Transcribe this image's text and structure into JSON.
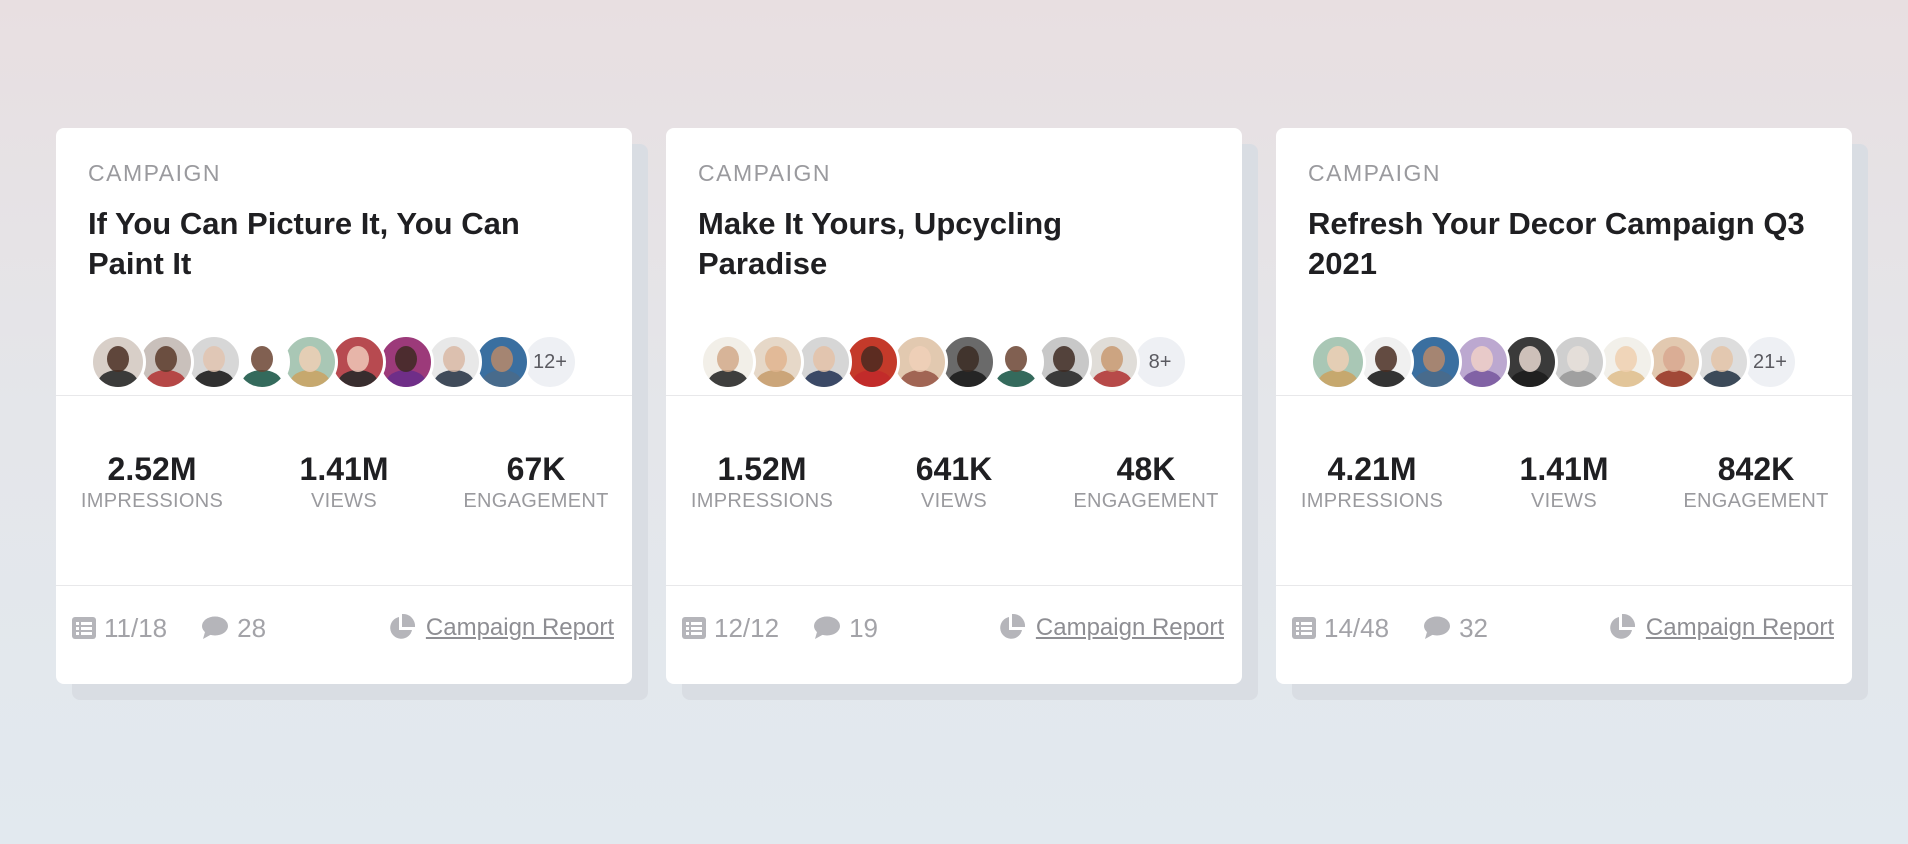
{
  "cards": [
    {
      "kicker": "CAMPAIGN",
      "title": "If You Can Picture It, You Can Paint It",
      "more_count": "12+",
      "avatars": [
        {
          "face": "#4a2e22",
          "body": "#2a2a2a",
          "bg": "#d8cfc8"
        },
        {
          "face": "#5a3a2a",
          "body": "#b23a3a",
          "bg": "#c9c0bb"
        },
        {
          "face": "#e2c4b0",
          "body": "#1e1e1e",
          "bg": "#d7d7d7"
        },
        {
          "face": "#6b4433",
          "body": "#1e5a4a",
          "bg": "#ffffff"
        },
        {
          "face": "#efcfb5",
          "body": "#c9a466",
          "bg": "#a9c7b5"
        },
        {
          "face": "#f0c8b8",
          "body": "#2a2a2a",
          "bg": "#b74a50"
        },
        {
          "face": "#3e2a22",
          "body": "#6a2e8a",
          "bg": "#9c3a7a"
        },
        {
          "face": "#d9b9a4",
          "body": "#2e3a4a",
          "bg": "#e8e8e8"
        },
        {
          "face": "#b88a6a",
          "body": "#4a6a8a",
          "bg": "#3a6fa0"
        }
      ],
      "stats": [
        {
          "value": "2.52M",
          "label": "IMPRESSIONS"
        },
        {
          "value": "1.41M",
          "label": "VIEWS"
        },
        {
          "value": "67K",
          "label": "ENGAGEMENT"
        }
      ],
      "tasks": "11/18",
      "comments": "28",
      "report_label": "Campaign Report"
    },
    {
      "kicker": "CAMPAIGN",
      "title": "Make It Yours, Upcycling Paradise",
      "more_count": "8+",
      "avatars": [
        {
          "face": "#d2a98a",
          "body": "#2a2a2a",
          "bg": "#f2efe8"
        },
        {
          "face": "#e0b58f",
          "body": "#c8a070",
          "bg": "#e6d8c8"
        },
        {
          "face": "#e4c2a8",
          "body": "#2a3a5a",
          "bg": "#d6d6d6"
        },
        {
          "face": "#4a2a20",
          "body": "#c22a2a",
          "bg": "#c43a2a"
        },
        {
          "face": "#f0d0b8",
          "body": "#9a5a4a",
          "bg": "#e2c9b0"
        },
        {
          "face": "#3a2a22",
          "body": "#1e1e1e",
          "bg": "#6a6a6a"
        },
        {
          "face": "#6b4433",
          "body": "#1e5a4a",
          "bg": "#ffffff"
        },
        {
          "face": "#3e2a22",
          "body": "#2a2a2a",
          "bg": "#c8c8c8"
        },
        {
          "face": "#c89a72",
          "body": "#b23a3a",
          "bg": "#e0ddd8"
        }
      ],
      "stats": [
        {
          "value": "1.52M",
          "label": "IMPRESSIONS"
        },
        {
          "value": "641K",
          "label": "VIEWS"
        },
        {
          "value": "48K",
          "label": "ENGAGEMENT"
        }
      ],
      "tasks": "12/12",
      "comments": "19",
      "report_label": "Campaign Report"
    },
    {
      "kicker": "CAMPAIGN",
      "title": "Refresh Your Decor Campaign Q3 2021",
      "more_count": "21+",
      "avatars": [
        {
          "face": "#efcfb5",
          "body": "#c9a466",
          "bg": "#a9c7b5"
        },
        {
          "face": "#4a2e22",
          "body": "#1e1e1e",
          "bg": "#f0f0f0"
        },
        {
          "face": "#b88a6a",
          "body": "#4a6a8a",
          "bg": "#3a6fa0"
        },
        {
          "face": "#f0d0c8",
          "body": "#7a5aa0",
          "bg": "#bca8d0"
        },
        {
          "face": "#e8d8d0",
          "body": "#1e1e1e",
          "bg": "#3a3a3a"
        },
        {
          "face": "#e8e0da",
          "body": "#9a9a9a",
          "bg": "#cfcfcf"
        },
        {
          "face": "#f0d0b0",
          "body": "#e0c090",
          "bg": "#f2f0ea"
        },
        {
          "face": "#d8a890",
          "body": "#9a3a2a",
          "bg": "#e2c9b0"
        },
        {
          "face": "#e4c4a8",
          "body": "#2a3a4a",
          "bg": "#dddddd"
        }
      ],
      "stats": [
        {
          "value": "4.21M",
          "label": "IMPRESSIONS"
        },
        {
          "value": "1.41M",
          "label": "VIEWS"
        },
        {
          "value": "842K",
          "label": "ENGAGEMENT"
        }
      ],
      "tasks": "14/48",
      "comments": "32",
      "report_label": "Campaign Report"
    }
  ]
}
